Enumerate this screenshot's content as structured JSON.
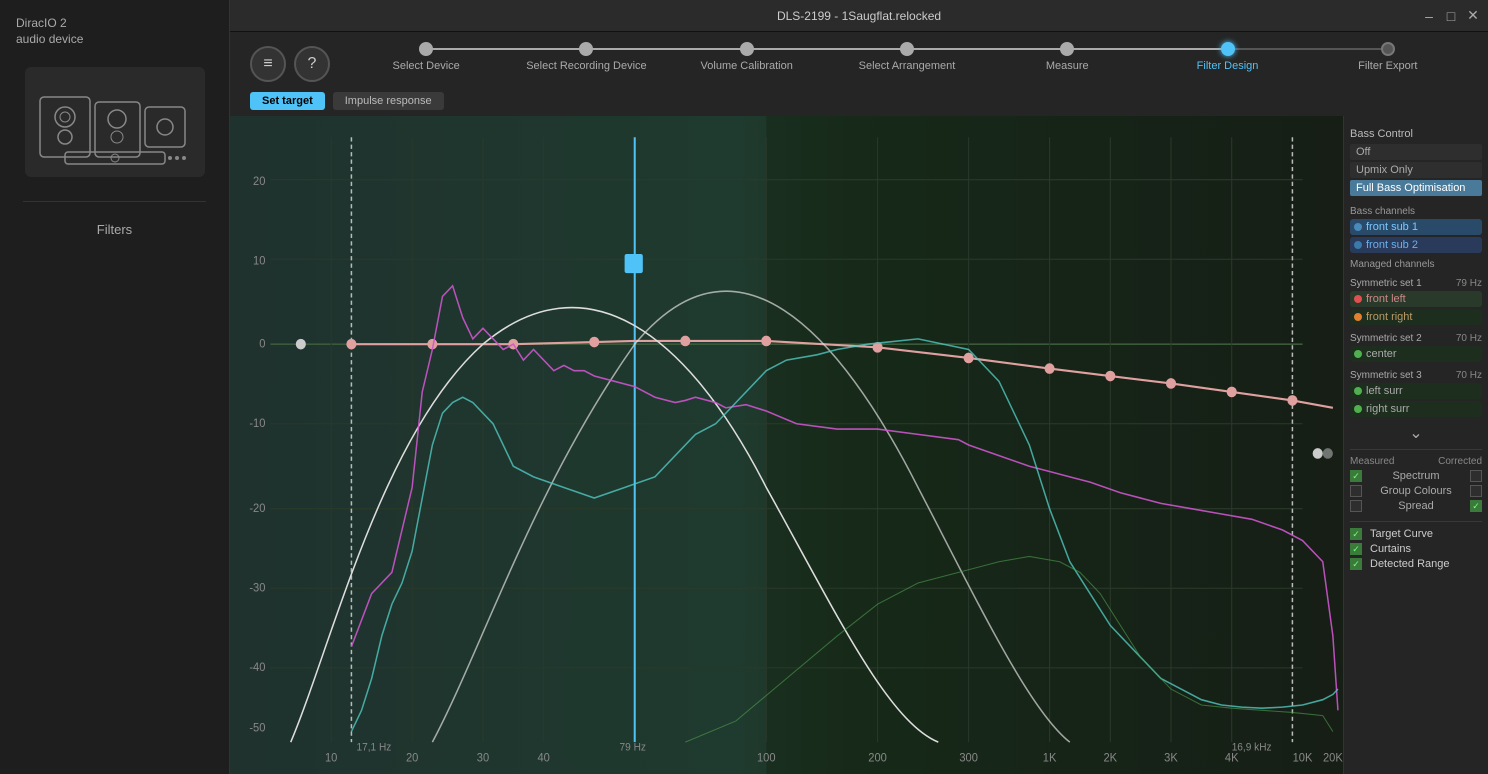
{
  "app": {
    "name": "DiracIO 2",
    "subtitle": "audio device",
    "titlebar_text": "DLS-2199 - 1Saugflat.relocked",
    "close": "✕",
    "minimize": "–",
    "restore": "□"
  },
  "wizard": {
    "menu_icon": "≡",
    "help_icon": "?",
    "steps": [
      {
        "id": "select-device",
        "label": "Select Device",
        "state": "completed"
      },
      {
        "id": "select-recording",
        "label": "Select Recording Device",
        "state": "completed"
      },
      {
        "id": "volume-calibration",
        "label": "Volume Calibration",
        "state": "completed"
      },
      {
        "id": "select-arrangement",
        "label": "Select Arrangement",
        "state": "completed"
      },
      {
        "id": "measure",
        "label": "Measure",
        "state": "completed"
      },
      {
        "id": "filter-design",
        "label": "Filter Design",
        "state": "active"
      },
      {
        "id": "filter-export",
        "label": "Filter Export",
        "state": "inactive"
      }
    ],
    "sub_buttons": [
      {
        "id": "set-target",
        "label": "Set target",
        "active": true
      },
      {
        "id": "impulse-response",
        "label": "Impulse response",
        "active": false
      }
    ]
  },
  "right_panel": {
    "bass_control_label": "Bass Control",
    "bass_options": [
      "Off",
      "Upmix Only",
      "Full Bass Optimisation"
    ],
    "bass_selected": "Full Bass Optimisation",
    "bass_channels_label": "Bass channels",
    "bass_channels": [
      "front sub 1",
      "front sub 2"
    ],
    "managed_channels_label": "Managed channels",
    "symmetric_sets": [
      {
        "label": "Symmetric set 1",
        "hz": "79 Hz",
        "channels": [
          {
            "name": "front left",
            "color": "red"
          },
          {
            "name": "front right",
            "color": "orange"
          }
        ]
      },
      {
        "label": "Symmetric set 2",
        "hz": "70 Hz",
        "channels": [
          {
            "name": "center",
            "color": "green"
          }
        ]
      },
      {
        "label": "Symmetric set 3",
        "hz": "70 Hz",
        "channels": [
          {
            "name": "left surr",
            "color": "green"
          },
          {
            "name": "right surr",
            "color": "green"
          }
        ]
      }
    ],
    "chevron_down": "⌄",
    "display_section": {
      "measured_label": "Measured",
      "corrected_label": "Corrected",
      "rows": [
        {
          "label": "Spectrum",
          "measured_checked": true,
          "corrected_checked": false
        },
        {
          "label": "Group Colours",
          "measured_checked": false,
          "corrected_checked": false
        },
        {
          "label": "Spread",
          "measured_checked": false,
          "corrected_checked": true
        }
      ]
    },
    "bottom_checks": [
      {
        "label": "Target Curve",
        "checked": true
      },
      {
        "label": "Curtains",
        "checked": true
      },
      {
        "label": "Detected Range",
        "checked": true
      }
    ]
  },
  "chart": {
    "y_labels": [
      "20",
      "10",
      "0",
      "-10",
      "-20",
      "-30",
      "-40",
      "-50"
    ],
    "x_labels": [
      "10",
      "20",
      "30",
      "40",
      "100",
      "200",
      "300",
      "1K",
      "2K",
      "3K",
      "4K",
      "10K",
      "20K"
    ],
    "freq_left": "17,1 Hz",
    "freq_center": "79 Hz",
    "freq_right": "16,9 kHz"
  },
  "sidebar": {
    "filters_label": "Filters"
  }
}
